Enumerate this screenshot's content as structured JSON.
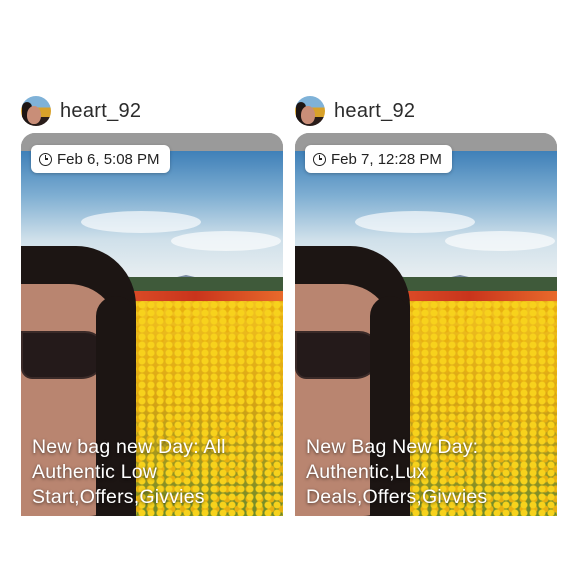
{
  "posts": [
    {
      "username": "heart_92",
      "timestamp": "Feb 6, 5:08 PM",
      "caption_lines": [
        "New bag new Day: All",
        "Authentic Low",
        "Start,Offers,Givvies"
      ]
    },
    {
      "username": "heart_92",
      "timestamp": "Feb 7, 12:28 PM",
      "caption_lines": [
        "New Bag New Day:",
        "Authentic,Lux",
        "Deals,Offers,Givvies"
      ]
    }
  ],
  "icons": {
    "avatar": "user-avatar",
    "clock": "clock-icon"
  },
  "colors": {
    "background": "#ffffff",
    "card_top": "#9a9a9a",
    "caption_text": "#ffffff",
    "badge": "#ffffff"
  }
}
